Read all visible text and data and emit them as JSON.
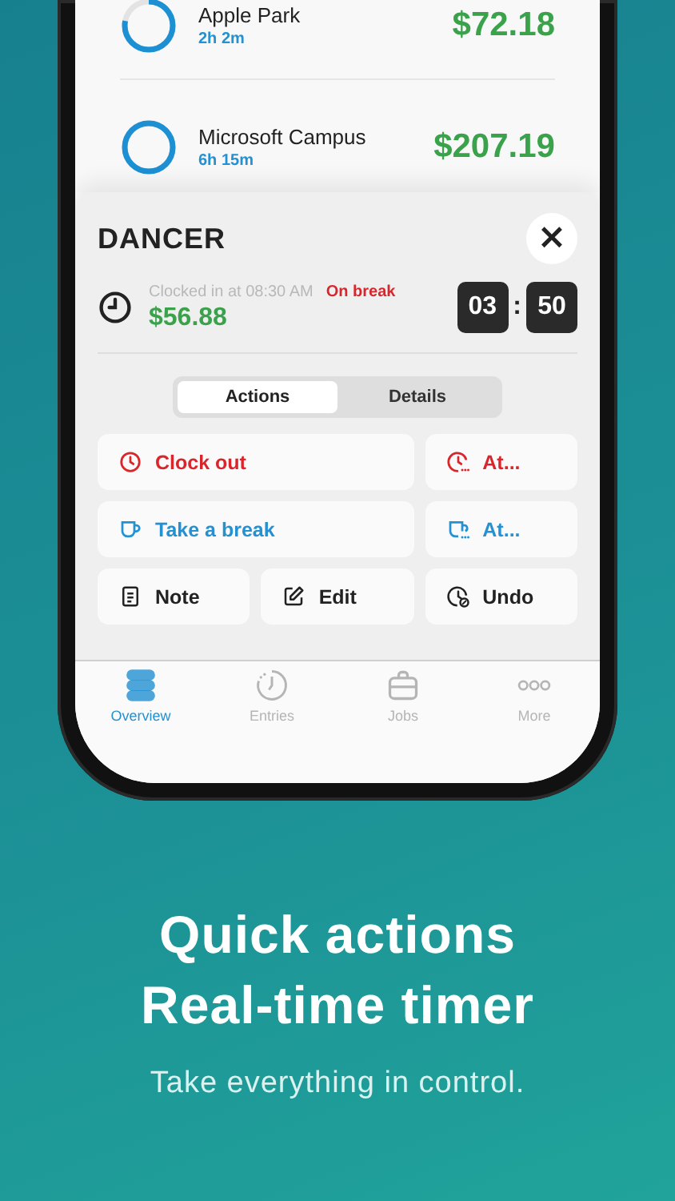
{
  "jobs": [
    {
      "name": "Apple Park",
      "duration": "2h 2m",
      "amount": "$72.18",
      "level": 0.78
    },
    {
      "name": "Microsoft Campus",
      "duration": "6h 15m",
      "amount": "$207.19",
      "level": 1
    }
  ],
  "sheet": {
    "title": "DANCER",
    "close": "×",
    "clocked_in": "Clocked in at 08:30 AM",
    "status": "On break",
    "earnings": "$56.88",
    "timer": {
      "hours": "03",
      "separator": ":",
      "minutes": "50"
    }
  },
  "segments": [
    {
      "label": "Actions",
      "selected": true
    },
    {
      "label": "Details",
      "selected": false
    }
  ],
  "actions": [
    {
      "kind": "clock-out",
      "label": "Clock out",
      "color": "#d9262c",
      "wide": true
    },
    {
      "kind": "clock-out-at",
      "label": "At...",
      "color": "#d9262c",
      "wide": false
    },
    {
      "kind": "break",
      "label": "Take a break",
      "color": "#2391d2",
      "wide": true
    },
    {
      "kind": "break-at",
      "label": "At...",
      "color": "#2391d2",
      "wide": false
    },
    {
      "kind": "note",
      "label": "Note",
      "color": "#222222",
      "wide": false
    },
    {
      "kind": "edit",
      "label": "Edit",
      "color": "#222222",
      "wide": false
    },
    {
      "kind": "undo",
      "label": "Undo",
      "color": "#222222",
      "wide": false
    }
  ],
  "tab_bar": [
    {
      "kind": "overview",
      "label": "Overview",
      "selected": true
    },
    {
      "kind": "entries",
      "label": "Entries",
      "selected": false
    },
    {
      "kind": "jobs",
      "label": "Jobs",
      "selected": false
    },
    {
      "kind": "more",
      "label": "More",
      "selected": false
    }
  ],
  "caption": {
    "headline": [
      "Quick actions",
      "Real-time timer"
    ],
    "subtitle": "Take everything in control."
  }
}
